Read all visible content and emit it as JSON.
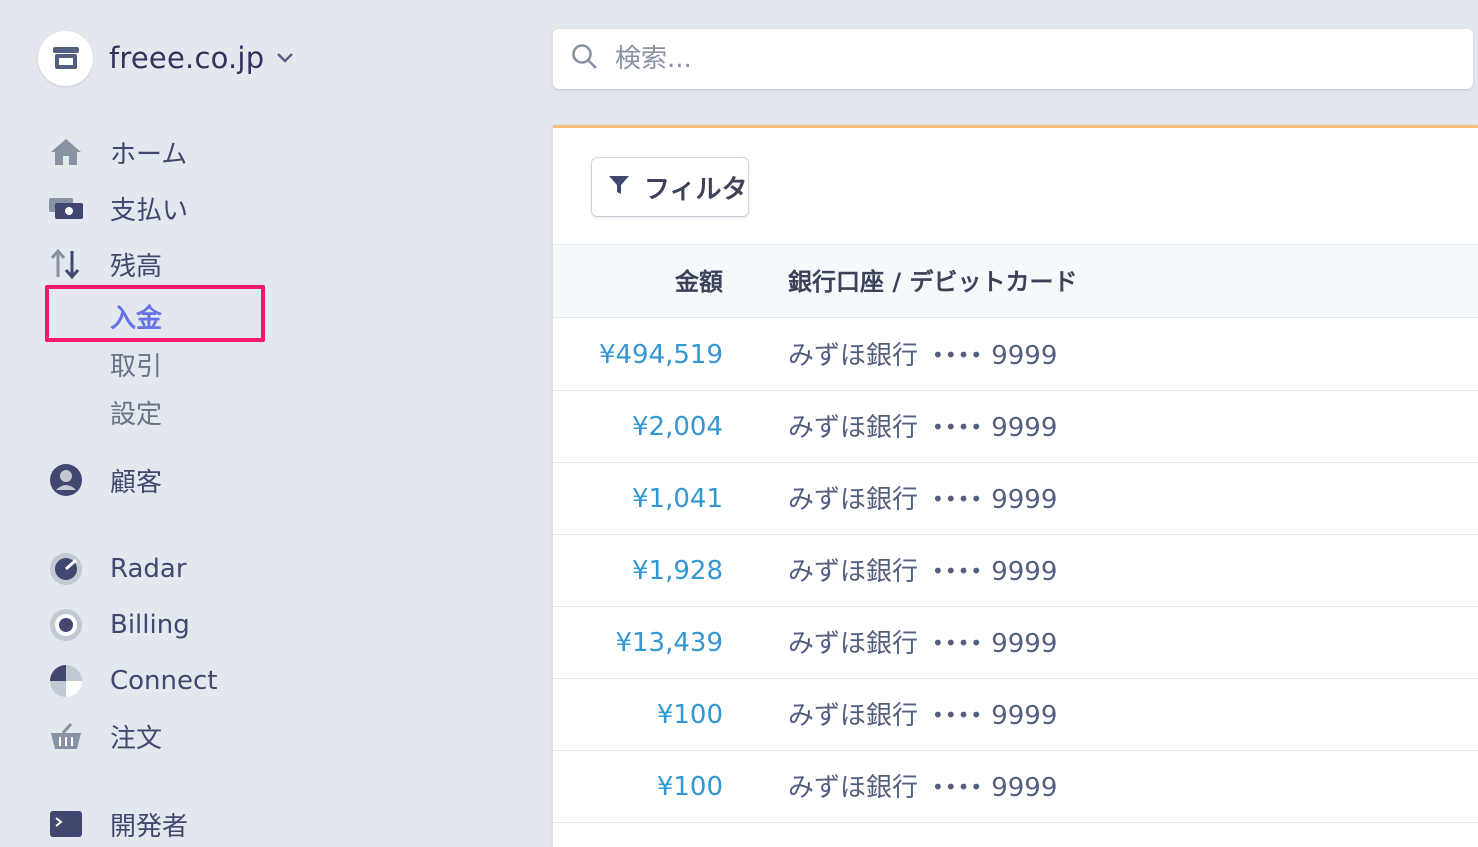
{
  "account": {
    "name": "freee.co.jp"
  },
  "search": {
    "placeholder": "検索..."
  },
  "nav": {
    "home": "ホーム",
    "payments": "支払い",
    "balance": "残高",
    "balance_sub": [
      "入金",
      "取引",
      "設定"
    ],
    "customers": "顧客",
    "radar": "Radar",
    "billing": "Billing",
    "connect": "Connect",
    "orders": "注文",
    "developers": "開発者"
  },
  "toolbar": {
    "filter_label": "フィルタ"
  },
  "table": {
    "columns": [
      "金額",
      "銀行口座 / デビットカード"
    ],
    "rows": [
      {
        "amount": "¥494,519",
        "bank": "みずほ銀行",
        "dots": "••••",
        "last4": "9999"
      },
      {
        "amount": "¥2,004",
        "bank": "みずほ銀行",
        "dots": "••••",
        "last4": "9999"
      },
      {
        "amount": "¥1,041",
        "bank": "みずほ銀行",
        "dots": "••••",
        "last4": "9999"
      },
      {
        "amount": "¥1,928",
        "bank": "みずほ銀行",
        "dots": "••••",
        "last4": "9999"
      },
      {
        "amount": "¥13,439",
        "bank": "みずほ銀行",
        "dots": "••••",
        "last4": "9999"
      },
      {
        "amount": "¥100",
        "bank": "みずほ銀行",
        "dots": "••••",
        "last4": "9999"
      },
      {
        "amount": "¥100",
        "bank": "みずほ銀行",
        "dots": "••••",
        "last4": "9999"
      }
    ]
  },
  "colors": {
    "accent": "#6772e5",
    "highlight": "#f5186c",
    "amount": "#3297d3"
  }
}
